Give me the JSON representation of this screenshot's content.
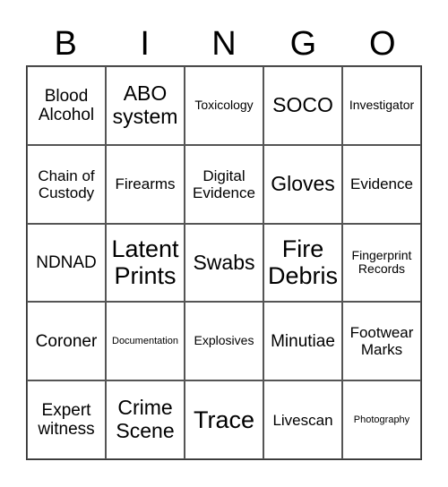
{
  "header": {
    "letters": [
      "B",
      "I",
      "N",
      "G",
      "O"
    ]
  },
  "card": {
    "rows": [
      [
        "Blood Alcohol",
        "ABO system",
        "Toxicology",
        "SOCO",
        "Investigator"
      ],
      [
        "Chain of Custody",
        "Firearms",
        "Digital Evidence",
        "Gloves",
        "Evidence"
      ],
      [
        "NDNAD",
        "Latent Prints",
        "Swabs",
        "Fire Debris",
        "Fingerprint Records"
      ],
      [
        "Coroner",
        "Documentation",
        "Explosives",
        "Minutiae",
        "Footwear Marks"
      ],
      [
        "Expert witness",
        "Crime Scene",
        "Trace",
        "Livescan",
        "Photography"
      ]
    ]
  },
  "colors": {
    "background": "#ffffff",
    "text": "#000000",
    "grid_line": "#555555"
  }
}
